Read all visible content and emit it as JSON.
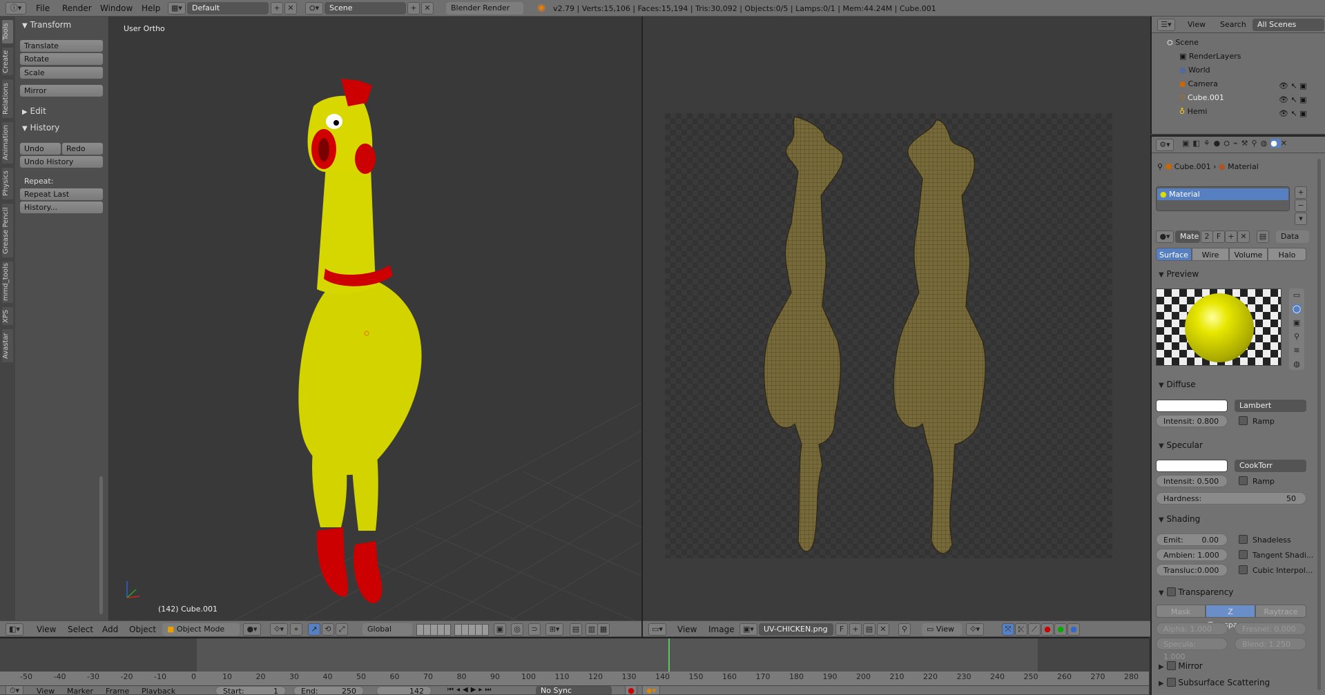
{
  "top_bar": {
    "menu": [
      "File",
      "Render",
      "Window",
      "Help"
    ],
    "screen_layout": "Default",
    "scene": "Scene",
    "render_engine": "Blender Render",
    "stats": "v2.79 | Verts:15,106 | Faces:15,194 | Tris:30,092 | Objects:0/5 | Lamps:0/1 | Mem:44.24M | Cube.001"
  },
  "tool_shelf": {
    "tabs": [
      "Tools",
      "Create",
      "Relations",
      "Animation",
      "Physics",
      "Grease Pencil",
      "mmd_tools",
      "XPS",
      "Avastar"
    ],
    "transform_header": "Transform",
    "transform_buttons": [
      "Translate",
      "Rotate",
      "Scale"
    ],
    "mirror": "Mirror",
    "edit_header": "Edit",
    "history_header": "History",
    "undo": "Undo",
    "redo": "Redo",
    "undo_history": "Undo History",
    "repeat_label": "Repeat:",
    "repeat_last": "Repeat Last",
    "history_btn": "History..."
  },
  "viewport": {
    "label": "User Ortho",
    "frame_info": "(142) Cube.001",
    "menu": [
      "View",
      "Select",
      "Add",
      "Object"
    ],
    "mode": "Object Mode",
    "orientation": "Global"
  },
  "uv_editor": {
    "menu": [
      "View",
      "Image"
    ],
    "image_name": "UV-CHICKEN.png",
    "f_label": "F",
    "view_label": "View"
  },
  "outliner": {
    "menu": [
      "View",
      "Search"
    ],
    "filter": "All Scenes",
    "items": [
      "Scene",
      "RenderLayers",
      "World",
      "Camera",
      "Cube.001",
      "Hemi"
    ]
  },
  "properties": {
    "breadcrumb_object": "Cube.001",
    "breadcrumb_material": "Material",
    "material_slot": "Material",
    "material_name": "Mate",
    "users": "2",
    "fake_user": "F",
    "data_link": "Data",
    "tabs": [
      "Surface",
      "Wire",
      "Volume",
      "Halo"
    ],
    "preview_header": "Preview",
    "diffuse": {
      "header": "Diffuse",
      "shader": "Lambert",
      "intensity": "Intensit: 0.800",
      "ramp": "Ramp"
    },
    "specular": {
      "header": "Specular",
      "shader": "CookTorr",
      "intensity": "Intensit: 0.500",
      "ramp": "Ramp",
      "hardness_label": "Hardness:",
      "hardness_value": "50"
    },
    "shading": {
      "header": "Shading",
      "emit": "Emit:",
      "emit_value": "0.00",
      "ambient": "Ambien: 1.000",
      "translucency": "Transluc:0.000",
      "shadeless": "Shadeless",
      "tangent": "Tangent Shadi...",
      "cubic": "Cubic Interpol..."
    },
    "transparency": {
      "header": "Transparency",
      "modes": [
        "Mask",
        "Z Transpare...",
        "Raytrace"
      ],
      "alpha": "Alpha:  1.000",
      "fresnel": "Fresnel:  0.000",
      "specular": "Specula: 1.000",
      "blend": "Blend:   1.250"
    },
    "mirror_header": "Mirror",
    "sss_header": "Subsurface Scattering"
  },
  "timeline": {
    "ruler": [
      -50,
      -40,
      -30,
      -20,
      -10,
      0,
      10,
      20,
      30,
      40,
      50,
      60,
      70,
      80,
      90,
      100,
      110,
      120,
      130,
      140,
      150,
      160,
      170,
      180,
      190,
      200,
      210,
      220,
      230,
      240,
      250,
      260,
      270,
      280
    ],
    "current_frame": 142,
    "menu": [
      "View",
      "Marker",
      "Frame",
      "Playback"
    ],
    "start_label": "Start:",
    "start_value": "1",
    "end_label": "End:",
    "end_value": "250",
    "frame_value": "142",
    "sync": "No Sync"
  }
}
